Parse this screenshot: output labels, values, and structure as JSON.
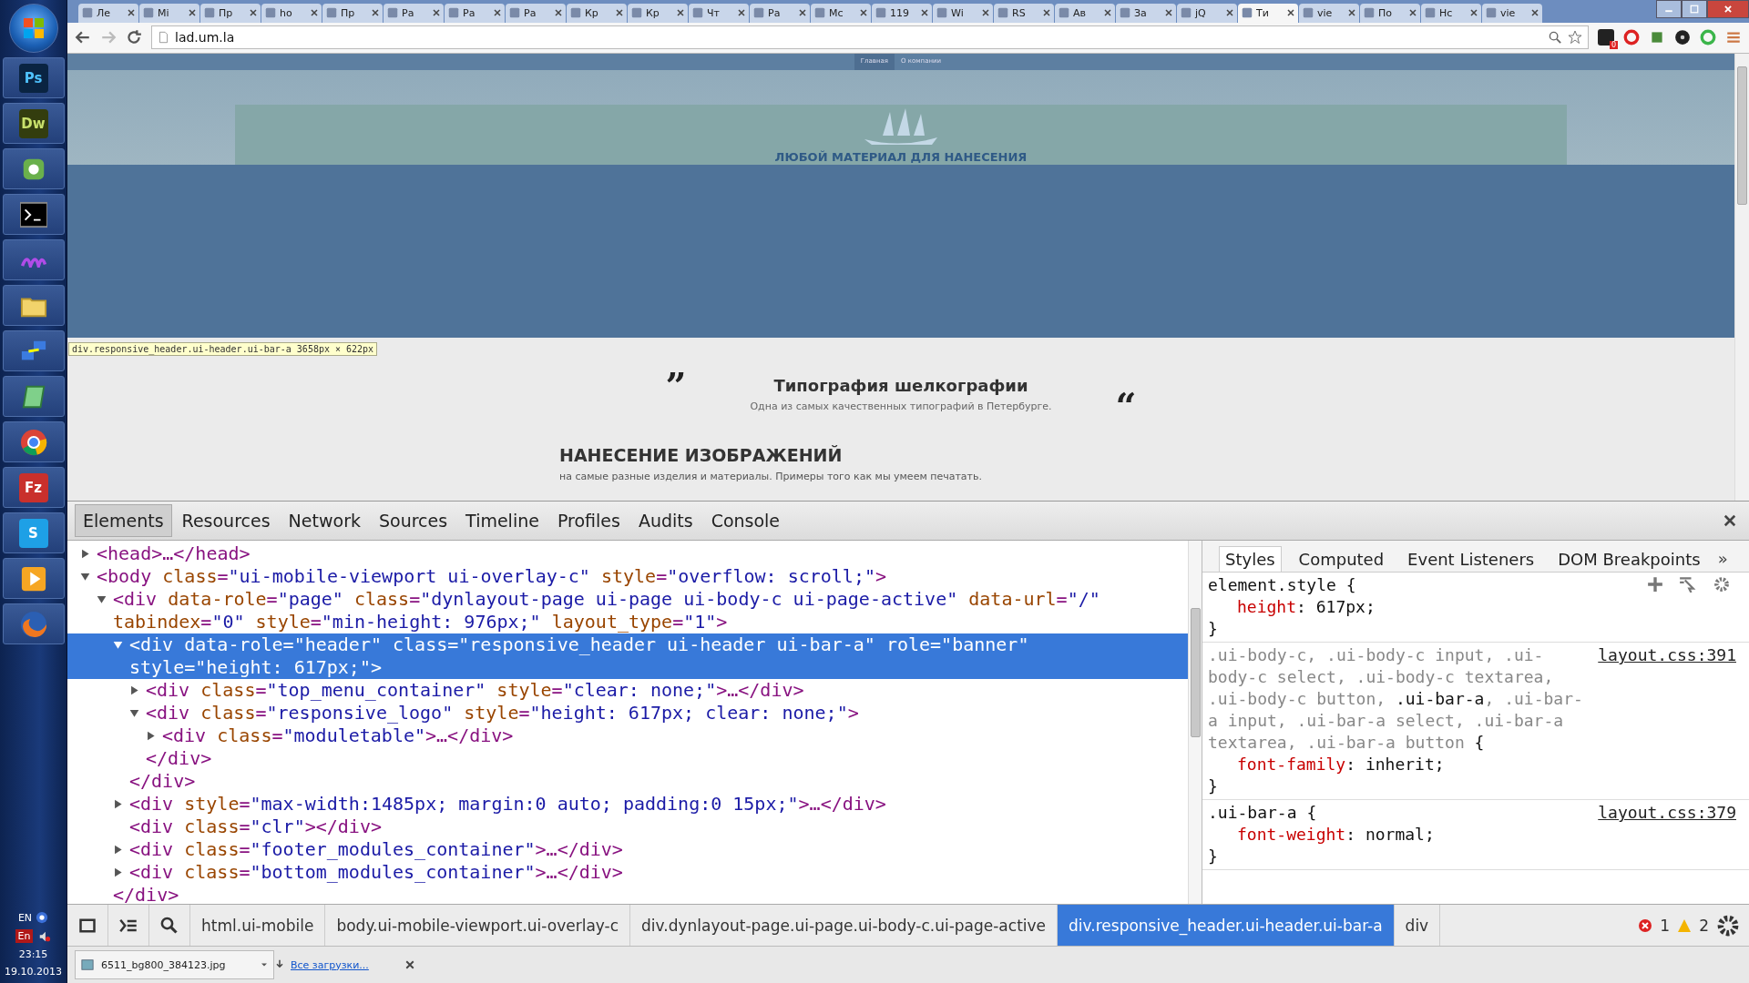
{
  "taskbar": {
    "apps": [
      {
        "kind": "start"
      },
      {
        "kind": "badge",
        "label": "Ps"
      },
      {
        "kind": "badge",
        "label": "Dw"
      },
      {
        "kind": "elephant"
      },
      {
        "kind": "terminal"
      },
      {
        "kind": "wave"
      },
      {
        "kind": "folder"
      },
      {
        "kind": "network"
      },
      {
        "kind": "notepad"
      },
      {
        "kind": "chrome"
      },
      {
        "kind": "badge",
        "label": "Fz"
      },
      {
        "kind": "badge",
        "label": "S"
      },
      {
        "kind": "player"
      },
      {
        "kind": "firefox"
      }
    ],
    "language": "EN",
    "input_indicator": "En",
    "time": "23:15",
    "date": "19.10.2013"
  },
  "browser": {
    "tabs": [
      {
        "label": "Ле",
        "selected": false
      },
      {
        "label": "Mi",
        "selected": false
      },
      {
        "label": "Пр",
        "selected": false
      },
      {
        "label": "ho",
        "selected": false
      },
      {
        "label": "Пр",
        "selected": false
      },
      {
        "label": "Ра",
        "selected": false
      },
      {
        "label": "Ра",
        "selected": false
      },
      {
        "label": "Ра",
        "selected": false
      },
      {
        "label": "Кр",
        "selected": false
      },
      {
        "label": "Кр",
        "selected": false
      },
      {
        "label": "Чт",
        "selected": false
      },
      {
        "label": "Ра",
        "selected": false
      },
      {
        "label": "Мс",
        "selected": false
      },
      {
        "label": "119",
        "selected": false
      },
      {
        "label": "Wi",
        "selected": false
      },
      {
        "label": "RS",
        "selected": false
      },
      {
        "label": "Ав",
        "selected": false
      },
      {
        "label": "За",
        "selected": false
      },
      {
        "label": "jQ",
        "selected": false
      },
      {
        "label": "Ти",
        "selected": true
      },
      {
        "label": "vie",
        "selected": false
      },
      {
        "label": "По",
        "selected": false
      },
      {
        "label": "Нс",
        "selected": false
      },
      {
        "label": "vie",
        "selected": false
      }
    ],
    "address": "lad.um.la",
    "extension_badge": "0"
  },
  "page": {
    "nav": [
      {
        "label": "Главная",
        "selected": true
      },
      {
        "label": "О компании",
        "selected": false
      }
    ],
    "hero_text": "ЛЮБОЙ МАТЕРИАЛ ДЛЯ НАНЕСЕНИЯ",
    "inspect_tooltip": {
      "selector": "div.responsive_header.ui-header.ui-bar-a",
      "size": "3658px × 622px"
    },
    "quote": {
      "open_mark": "”",
      "close_mark": "“",
      "title": "Типография шелкографии",
      "subtitle": "Одна из самых качественных типографий в Петербурге."
    },
    "section": {
      "title": "НАНЕСЕНИЕ ИЗОБРАЖЕНИЙ",
      "text": "на самые разные изделия и материалы. Примеры того как мы умеем печатать."
    }
  },
  "devtools": {
    "tabs": [
      {
        "label": "Elements",
        "selected": true
      },
      {
        "label": "Resources",
        "selected": false
      },
      {
        "label": "Network",
        "selected": false
      },
      {
        "label": "Sources",
        "selected": false
      },
      {
        "label": "Timeline",
        "selected": false
      },
      {
        "label": "Profiles",
        "selected": false
      },
      {
        "label": "Audits",
        "selected": false
      },
      {
        "label": "Console",
        "selected": false
      }
    ],
    "dom": [
      {
        "kind": "element",
        "open_tag": "<head>…</head>",
        "expanded": false,
        "selected": false
      },
      {
        "kind": "element",
        "open_tag": "<body class=\"ui-mobile-viewport ui-overlay-c\" style=\"overflow: scroll;\">",
        "expanded": true,
        "selected": false,
        "children": [
          {
            "kind": "element",
            "open_tag": "<div data-role=\"page\" class=\"dynlayout-page ui-page ui-body-c ui-page-active\" data-url=\"/\" tabindex=\"0\" style=\"min-height: 976px;\" layout_type=\"1\">",
            "close_tag": "</div>",
            "expanded": true,
            "selected": false,
            "children": [
              {
                "kind": "element",
                "open_tag": "<div data-role=\"header\" class=\"responsive_header ui-header ui-bar-a\" role=\"banner\" style=\"height: 617px;\">",
                "close_tag": "</div>",
                "expanded": true,
                "selected": true,
                "children": [
                  {
                    "kind": "element",
                    "open_tag": "<div class=\"top_menu_container\" style=\"clear: none;\">…</div>",
                    "expanded": false,
                    "selected": false
                  },
                  {
                    "kind": "element",
                    "open_tag": "<div class=\"responsive_logo\" style=\"height: 617px; clear: none;\">",
                    "close_tag": "</div>",
                    "expanded": true,
                    "selected": false,
                    "children": [
                      {
                        "kind": "element",
                        "open_tag": "<div class=\"moduletable\">…</div>",
                        "expanded": false,
                        "selected": false
                      }
                    ]
                  }
                ]
              },
              {
                "kind": "element",
                "open_tag": "<div style=\"max-width:1485px; margin:0 auto; padding:0 15px;\">…</div>",
                "expanded": false,
                "selected": false
              },
              {
                "kind": "leaf",
                "open_tag": "<div class=\"clr\"></div>",
                "selected": false
              },
              {
                "kind": "element",
                "open_tag": "<div class=\"footer_modules_container\">…</div>",
                "expanded": false,
                "selected": false
              },
              {
                "kind": "element",
                "open_tag": "<div class=\"bottom_modules_container\">…</div>",
                "expanded": false,
                "selected": false
              }
            ]
          }
        ]
      }
    ],
    "sidebar_tabs": [
      {
        "label": "Styles",
        "selected": true
      },
      {
        "label": "Computed",
        "selected": false
      },
      {
        "label": "Event Listeners",
        "selected": false
      },
      {
        "label": "DOM Breakpoints",
        "selected": false
      }
    ],
    "sidebar_more": "»",
    "rules": [
      {
        "selector": [
          {
            "text": "element.style",
            "matched": true
          },
          {
            "text": " {",
            "matched": true
          }
        ],
        "props": [
          "height: 617px;"
        ],
        "close": "}"
      },
      {
        "selector": [
          {
            "text": ".ui-body-c, .ui-body-c input, .ui-body-c select, .ui-body-c textarea, .ui-body-c button, ",
            "matched": false
          },
          {
            "text": ".ui-bar-a",
            "matched": true
          },
          {
            "text": ", .ui-bar-a input, .ui-bar-a select, .ui-bar-a textarea, .ui-bar-a button",
            "matched": false
          },
          {
            "text": " {",
            "matched": true
          }
        ],
        "source": "layout.css:391",
        "props": [
          "font-family: inherit;"
        ],
        "close": "}"
      },
      {
        "selector": [
          {
            "text": ".ui-bar-a",
            "matched": true
          },
          {
            "text": " {",
            "matched": true
          }
        ],
        "source": "layout.css:379",
        "props": [
          "font-weight: normal;"
        ],
        "close": "}"
      }
    ],
    "breadcrumbs": [
      {
        "label": "html.ui-mobile",
        "selected": false
      },
      {
        "label": "body.ui-mobile-viewport.ui-overlay-c",
        "selected": false
      },
      {
        "label": "div.dynlayout-page.ui-page.ui-body-c.ui-page-active",
        "selected": false
      },
      {
        "label": "div.responsive_header.ui-header.ui-bar-a",
        "selected": true
      },
      {
        "label": "div",
        "selected": false
      }
    ],
    "errors": "1",
    "warnings": "2"
  },
  "downloads": {
    "file": "6511_bg800_384123.jpg",
    "all_link": "Все загрузки..."
  }
}
